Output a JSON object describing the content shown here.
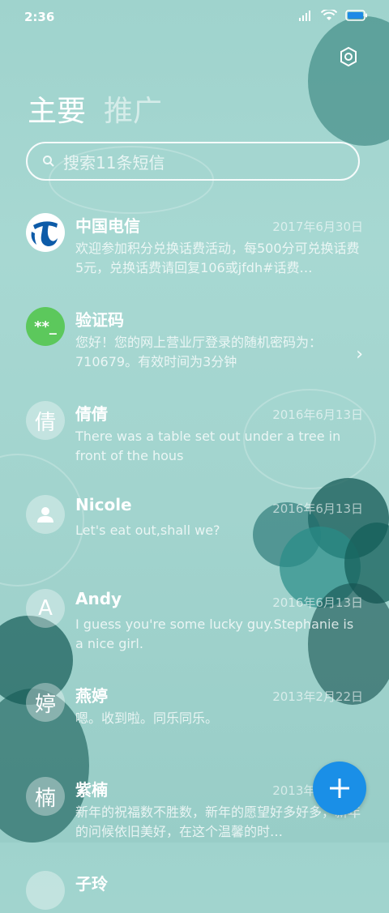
{
  "status_bar": {
    "time": "2:36"
  },
  "tabs": [
    {
      "label": "主要"
    },
    {
      "label": "推广"
    }
  ],
  "search": {
    "placeholder": "搜索11条短信"
  },
  "messages": [
    {
      "name": "中国电信",
      "date": "2017年6月30日",
      "preview": "欢迎参加积分兑换话费活动，每500分可兑换话费5元，兑换话费请回复106或jfdh#话费…",
      "avatar": "telecom-logo"
    },
    {
      "name": "验证码",
      "date": "",
      "preview": "您好！您的网上营业厅登录的随机密码为：710679。有效时间为3分钟",
      "avatar_text": "**_"
    },
    {
      "name": "倩倩",
      "date": "2016年6月13日",
      "preview": "There was a table set out under a tree in front of the hous",
      "avatar_text": "倩"
    },
    {
      "name": "Nicole",
      "date": "2016年6月13日",
      "preview": "Let's eat out,shall we?",
      "avatar": "person-icon"
    },
    {
      "name": "Andy",
      "date": "2016年6月13日",
      "preview": "I guess you're some lucky guy.Stephanie is a nice girl.",
      "avatar_text": "A"
    },
    {
      "name": "燕婷",
      "date": "2013年2月22日",
      "preview": "嗯。收到啦。同乐同乐。",
      "avatar_text": "婷"
    },
    {
      "name": "紫楠",
      "date": "2013年2月22日",
      "preview": "新年的祝福数不胜数，新年的愿望好多好多，新年的问候依旧美好，在这个温馨的时…",
      "avatar_text": "楠"
    },
    {
      "name": "子玲",
      "date": "",
      "preview": "",
      "avatar_text": ""
    }
  ],
  "colors": {
    "accent": "#1a8fe7",
    "verify_green": "#5cc85c",
    "telecom_blue": "#0d5ba8"
  }
}
